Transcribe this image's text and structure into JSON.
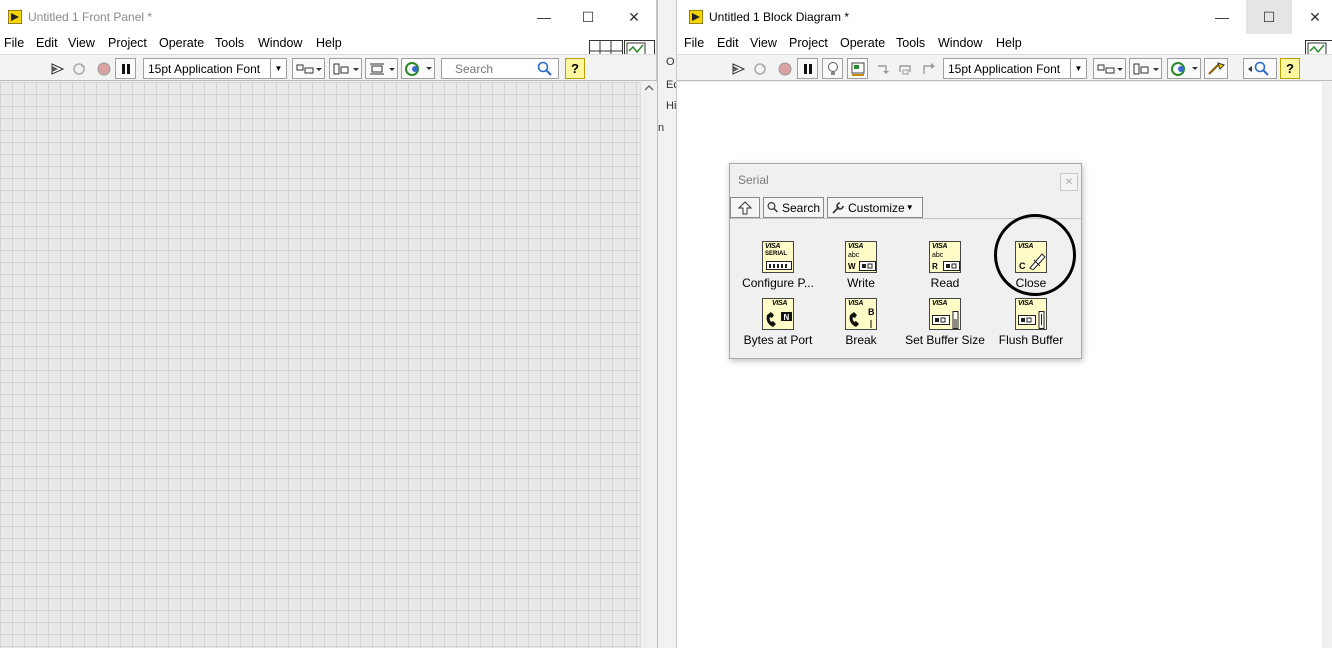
{
  "front_panel": {
    "title": "Untitled 1 Front Panel *",
    "menu": [
      "File",
      "Edit",
      "View",
      "Project",
      "Operate",
      "Tools",
      "Window",
      "Help"
    ],
    "font_select": "15pt Application Font",
    "search_placeholder": "Search"
  },
  "gap_panel": {
    "items": [
      "O",
      "Ec",
      "Hi",
      "n"
    ]
  },
  "block_diagram": {
    "title": "Untitled 1 Block Diagram *",
    "menu": [
      "File",
      "Edit",
      "View",
      "Project",
      "Operate",
      "Tools",
      "Window",
      "Help"
    ],
    "font_select": "15pt Application Font"
  },
  "palette": {
    "title": "Serial",
    "search_label": "Search",
    "customize_label": "Customize",
    "items": [
      {
        "label": "Configure P...",
        "glyph": "SERIAL"
      },
      {
        "label": "Write",
        "glyph": "abc"
      },
      {
        "label": "Read",
        "glyph": "abc"
      },
      {
        "label": "Close",
        "glyph": "C"
      },
      {
        "label": "Bytes at Port",
        "glyph": "N"
      },
      {
        "label": "Break",
        "glyph": "B"
      },
      {
        "label": "Set Buffer Size",
        "glyph": ""
      },
      {
        "label": "Flush Buffer",
        "glyph": ""
      }
    ],
    "visa_text": "VISA"
  },
  "colors": {
    "vi_icon_fill": "#fffcc8",
    "help_yellow": "#fff6a0",
    "highlight_circle": "#000000"
  }
}
